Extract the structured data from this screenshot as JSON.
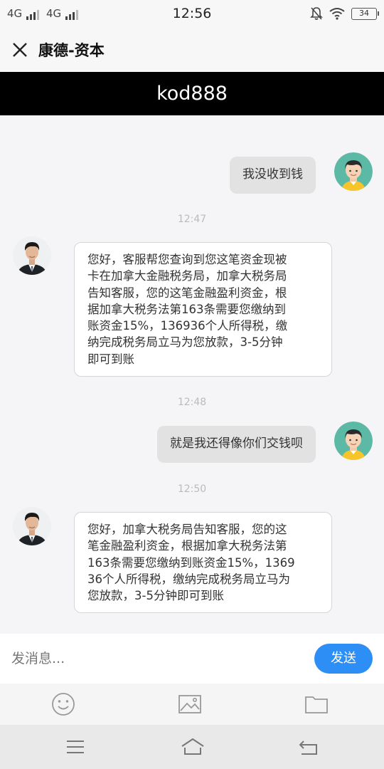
{
  "status_bar": {
    "signal_1": "4G",
    "signal_2": "4G",
    "time": "12:56",
    "battery": "34",
    "icons": [
      "mute-icon",
      "wifi-icon",
      "battery-icon"
    ]
  },
  "header": {
    "close_icon": "close-icon",
    "title": "康德-资本",
    "banner": "kod888"
  },
  "messages": [
    {
      "side": "out",
      "text": "我没收到钱"
    },
    {
      "timestamp": "12:47"
    },
    {
      "side": "in",
      "lines": [
        "您好，客服帮您查询到您这笔资金现被",
        "卡在加拿大金融税务局，加拿大税务局",
        "告知客服，您的这笔金融盈利资金，根",
        "据加拿大税务法第163条需要您缴纳到",
        "账资金15%，136936个人所得税，缴",
        "纳完成税务局立马为您放款，3-5分钟",
        "即可到账"
      ]
    },
    {
      "timestamp": "12:48"
    },
    {
      "side": "out",
      "text": "就是我还得像你们交钱呗"
    },
    {
      "timestamp": "12:50"
    },
    {
      "side": "in",
      "lines": [
        "您好，加拿大税务局告知客服，您的这",
        "笔金融盈利资金，根据加拿大税务法第",
        "163条需要您缴纳到账资金15%，1369",
        "36个人所得税，缴纳完成税务局立马为",
        "您放款，3-5分钟即可到账"
      ]
    }
  ],
  "input": {
    "placeholder": "发消息...",
    "send_label": "发送"
  },
  "toolbar": [
    "emoji-icon",
    "image-icon",
    "folder-icon"
  ],
  "nav": [
    "menu-icon",
    "home-icon",
    "back-icon"
  ],
  "colors": {
    "accent": "#2d8ef5",
    "banner_bg": "#000000",
    "bubble_out": "#e2e2e2",
    "bubble_in": "#ffffff",
    "avatar_user_bg": "#5bb9a5"
  }
}
